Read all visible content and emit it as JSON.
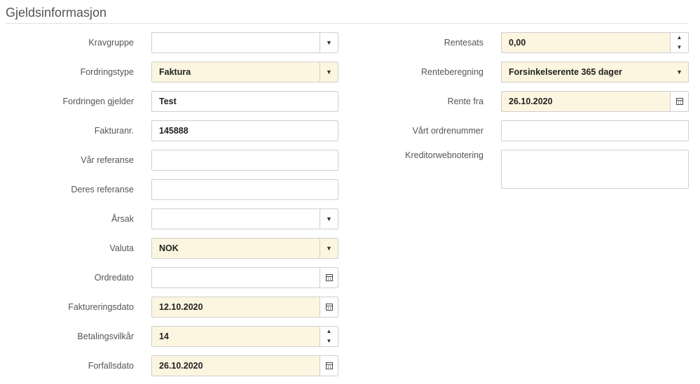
{
  "section": {
    "title": "Gjeldsinformasjon"
  },
  "left_fields": [
    {
      "label": "Kravgruppe",
      "value": "",
      "control": "select"
    },
    {
      "label": "Fordringstype",
      "value": "Faktura",
      "control": "select"
    },
    {
      "label": "Fordringen gjelder",
      "value": "Test",
      "control": "text"
    },
    {
      "label": "Fakturanr.",
      "value": "145888",
      "control": "text"
    },
    {
      "label": "Vår referanse",
      "value": "",
      "control": "text"
    },
    {
      "label": "Deres referanse",
      "value": "",
      "control": "text"
    },
    {
      "label": "Årsak",
      "value": "",
      "control": "select"
    },
    {
      "label": "Valuta",
      "value": "NOK",
      "control": "select"
    },
    {
      "label": "Ordredato",
      "value": "",
      "control": "date"
    },
    {
      "label": "Faktureringsdato",
      "value": "12.10.2020",
      "control": "date"
    },
    {
      "label": "Betalingsvilkår",
      "value": "14",
      "control": "number"
    },
    {
      "label": "Forfallsdato",
      "value": "26.10.2020",
      "control": "date"
    }
  ],
  "right_fields": [
    {
      "label": "Rentesats",
      "value": "0,00",
      "control": "number"
    },
    {
      "label": "Renteberegning",
      "value": "Forsinkelserente 365 dager",
      "control": "select"
    },
    {
      "label": "Rente fra",
      "value": "26.10.2020",
      "control": "date"
    },
    {
      "label": "Vårt ordrenummer",
      "value": "",
      "control": "text"
    },
    {
      "label": "Kreditorwebnotering",
      "value": "",
      "control": "textarea"
    }
  ],
  "icons": {
    "dropdown": "caret-down-icon",
    "calendar": "calendar-icon",
    "spinner_up": "caret-up-icon",
    "spinner_down": "caret-down-icon"
  },
  "colors": {
    "filled_background": "#fcf5e0",
    "empty_background": "#ffffff",
    "border": "#cfcfcf",
    "label_text": "#555555"
  }
}
